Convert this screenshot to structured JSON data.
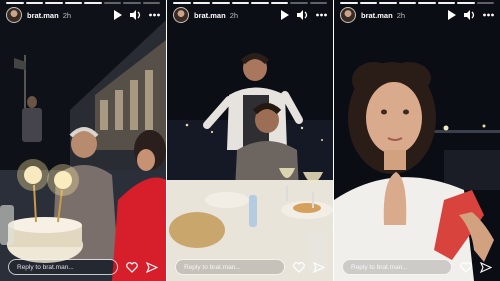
{
  "stories": [
    {
      "username": "brat.man",
      "time": "2h",
      "reply_placeholder": "Reply to brat.man...",
      "icons": {
        "avatar": "profile-avatar",
        "play": "play-icon",
        "sound": "volume-icon",
        "more": "more-icon",
        "like": "heart-icon",
        "share": "send-icon"
      }
    },
    {
      "username": "brat.man",
      "time": "2h",
      "reply_placeholder": "Reply to brat.man...",
      "icons": {
        "avatar": "profile-avatar",
        "play": "play-icon",
        "sound": "volume-icon",
        "more": "more-icon",
        "like": "heart-icon",
        "share": "send-icon"
      }
    },
    {
      "username": "brat.man",
      "time": "2h",
      "reply_placeholder": "Reply to brat.man...",
      "icons": {
        "avatar": "profile-avatar",
        "play": "play-icon",
        "sound": "volume-icon",
        "more": "more-icon",
        "like": "heart-icon",
        "share": "send-icon"
      }
    }
  ],
  "colors": {
    "background": "#0b0d12",
    "text": "#ffffff",
    "divider": "#ffffff"
  }
}
